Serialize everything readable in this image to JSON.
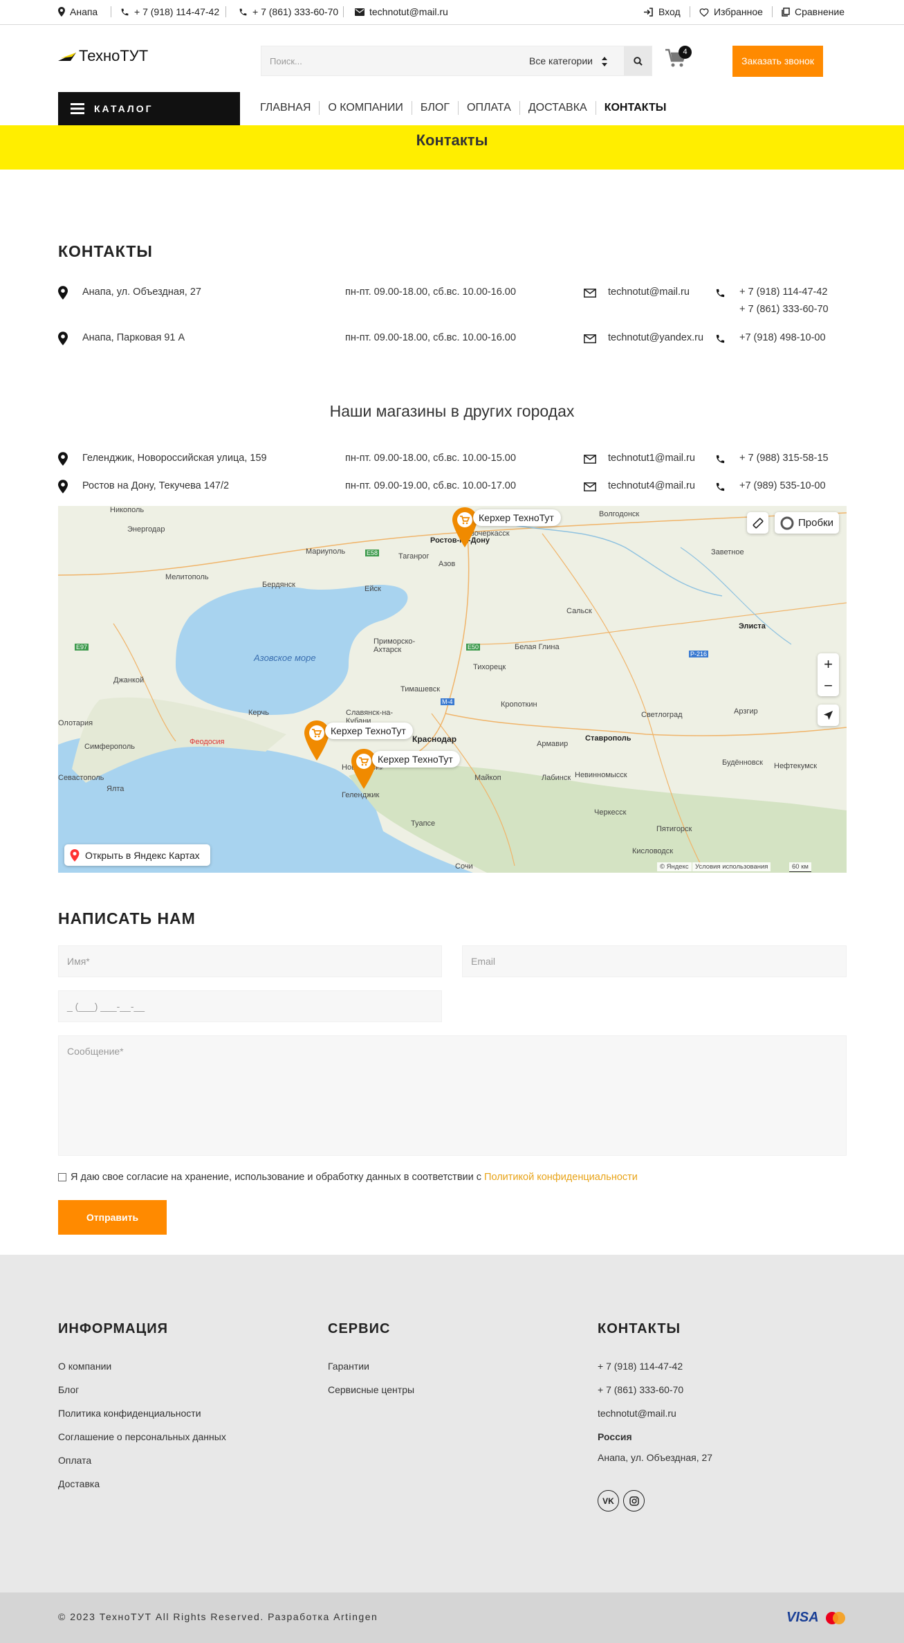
{
  "topbar": {
    "city": "Анапа",
    "phone1": "+ 7 (918) 114-47-42",
    "phone2": "+ 7 (861) 333-60-70",
    "email": "technotut@mail.ru",
    "login": "Вход",
    "favorites": "Избранное",
    "compare": "Сравнение"
  },
  "header": {
    "logo": "ТехноТУТ",
    "search_placeholder": "Поиск...",
    "category_select": "Все категории",
    "cart_count": "4",
    "call_button": "Заказать звонок"
  },
  "nav": {
    "catalog": "КАТАЛОГ",
    "items": [
      "ГЛАВНАЯ",
      "О КОМПАНИИ",
      "БЛОГ",
      "ОПЛАТА",
      "ДОСТАВКА",
      "КОНТАКТЫ"
    ],
    "active_index": 5
  },
  "page_title": "Контакты",
  "contacts": {
    "heading": "КОНТАКТЫ",
    "rows": [
      {
        "address": "Анапа, ул. Объездная, 27",
        "hours": "пн-пт. 09.00-18.00, сб.вс. 10.00-16.00",
        "email": "technotut@mail.ru",
        "phone": "+ 7 (918) 114-47-42",
        "phone2": "+ 7 (861) 333-60-70"
      },
      {
        "address": "Анапа, Парковая 91 А",
        "hours": "пн-пт. 09.00-18.00, сб.вс. 10.00-16.00",
        "email": "technotut@yandex.ru",
        "phone": "+7 (918) 498-10-00"
      }
    ]
  },
  "other_cities": {
    "heading": "Наши магазины в других городах",
    "rows": [
      {
        "address": "Геленджик, Новороссийская улица, 159",
        "hours": "пн-пт. 09.00-18.00, сб.вс. 10.00-15.00",
        "email": "technotut1@mail.ru",
        "phone": "+ 7 (988) 315-58-15"
      },
      {
        "address": "Ростов на Дону, Текучева 147/2",
        "hours": "пн-пт. 09.00-19.00, сб.вс. 10.00-17.00",
        "email": "technotut4@mail.ru",
        "phone": "+7 (989) 535-10-00"
      }
    ]
  },
  "map": {
    "marker_label": "Керхер ТехноТут",
    "traffic": "Пробки",
    "zoom_in": "+",
    "zoom_out": "−",
    "open_link": "Открыть в Яндекс Картах",
    "copyright": "© Яндекс",
    "terms": "Условия использования",
    "scale": "60 км",
    "sea": "Азовское море",
    "cities": [
      "Никополь",
      "Энергодар",
      "Мелитополь",
      "Бердянск",
      "Мариуполь",
      "Таганрог",
      "Ростов-на-Дону",
      "Азов",
      "Новочеркасск",
      "Волгодонск",
      "Заветное",
      "Сальск",
      "Элиста",
      "Ейск",
      "Приморско-Ахтарск",
      "Тихорецк",
      "Белая Глина",
      "Тимашевск",
      "Кропоткин",
      "Джанкой",
      "Керчь",
      "Славянск-на-Кубани",
      "Краснодар",
      "Армавир",
      "Ставрополь",
      "Светлоград",
      "Арзгир",
      "Симферополь",
      "Феодосия",
      "Новороссийск",
      "Геленджик",
      "Майкоп",
      "Лабинск",
      "Невинномысск",
      "Будённовск",
      "Нефтекумск",
      "Севастополь",
      "Ялта",
      "Туапсе",
      "Черкесск",
      "Пятигорск",
      "Кисловодск",
      "Сочи",
      "Олотария"
    ],
    "roads": [
      "E58",
      "E97",
      "E50",
      "M-4",
      "P-216"
    ]
  },
  "form": {
    "heading": "НАПИСАТЬ НАМ",
    "name_placeholder": "Имя*",
    "email_placeholder": "Email",
    "phone_placeholder": "_ (___) ___-__-__",
    "message_placeholder": "Сообщение*",
    "consent_text": "Я даю свое согласие на хранение, использование и обработку данных в соответствии с ",
    "consent_link": "Политикой конфиденциальности",
    "submit": "Отправить"
  },
  "footer": {
    "info_heading": "ИНФОРМАЦИЯ",
    "info_links": [
      "О компании",
      "Блог",
      "Политика конфиденциальности",
      "Соглашение о персональных данных",
      "Оплата",
      "Доставка"
    ],
    "service_heading": "СЕРВИС",
    "service_links": [
      "Гарантии",
      "Сервисные центры"
    ],
    "contacts_heading": "КОНТАКТЫ",
    "phone1": "+ 7 (918) 114-47-42",
    "phone2": "+ 7 (861) 333-60-70",
    "email": "technotut@mail.ru",
    "country": "Россия",
    "address": "Анапа, ул. Объездная, 27",
    "vk": "VK",
    "copyright": "© 2023 ТехноТУТ All Rights Reserved. Разработка Artingen",
    "visa": "VISA"
  },
  "colors": {
    "accent": "#ff8a00",
    "band": "#ffee00",
    "dark": "#111111",
    "link": "#e8a317"
  }
}
